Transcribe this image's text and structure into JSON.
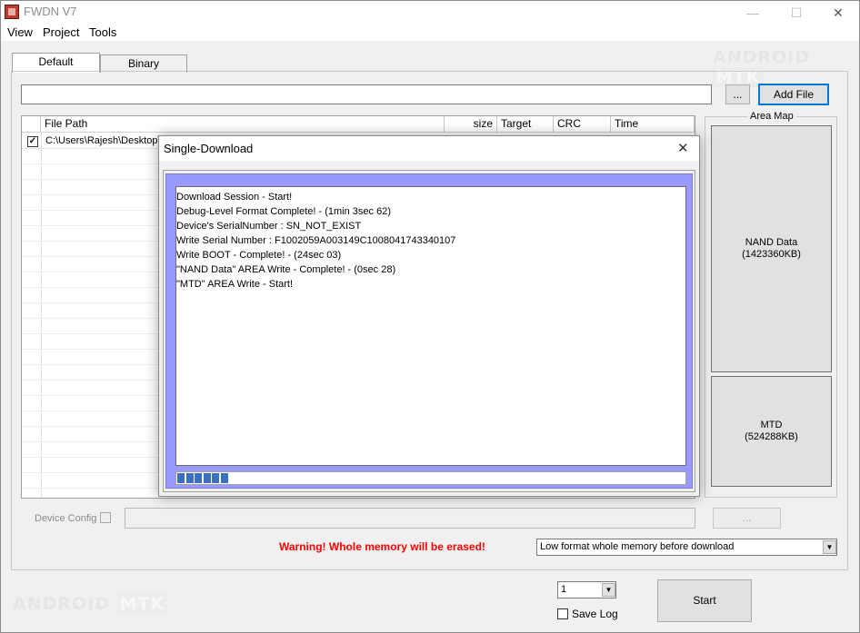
{
  "window": {
    "title": "FWDN V7",
    "minimize": "—",
    "maximize": "☐",
    "close": "✕"
  },
  "menu": [
    {
      "label": "View"
    },
    {
      "label": "Project"
    },
    {
      "label": "Tools"
    }
  ],
  "watermark": {
    "part1": "ANDROID",
    "part2": "MTK"
  },
  "tabs": [
    {
      "label": "Default"
    },
    {
      "label": "Binary"
    }
  ],
  "file_input": {
    "value": "",
    "browse_label": "...",
    "add_label": "Add File"
  },
  "file_table": {
    "columns": [
      "File Path",
      "size",
      "Target",
      "CRC",
      "Time"
    ],
    "rows": [
      {
        "checked": true,
        "path": "C:\\Users\\Rajesh\\Desktop\\"
      }
    ]
  },
  "area_map": {
    "title": "Area Map",
    "blocks": [
      {
        "name": "NAND Data",
        "size": "(1423360KB)"
      },
      {
        "name": "MTD",
        "size": "(524288KB)"
      }
    ]
  },
  "device_config": {
    "label": "Device Config",
    "checked": false,
    "value": "",
    "browse_label": "..."
  },
  "warning": "Warning! Whole memory will be erased!",
  "format_select": {
    "value": "Low format whole memory before download"
  },
  "count_select": {
    "value": "1"
  },
  "save_log": {
    "label": "Save Log",
    "checked": false
  },
  "start_label": "Start",
  "dialog": {
    "title": "Single-Download",
    "close": "✕",
    "log": [
      "Download Session - Start!",
      "Debug-Level Format Complete! - (1min 3sec 62)",
      "Device's SerialNumber : SN_NOT_EXIST",
      "Write Serial Number : F1002059A003149C1008041743340107",
      "Write BOOT - Complete! - (24sec 03)",
      "\"NAND Data\" AREA Write - Complete! - (0sec 28)",
      "\"MTD\" AREA Write - Start!"
    ],
    "progress_segments": 6,
    "progress_total_segments": 56,
    "colors": {
      "log_frame": "#9999ff",
      "progress": "#3b6fc0"
    }
  }
}
